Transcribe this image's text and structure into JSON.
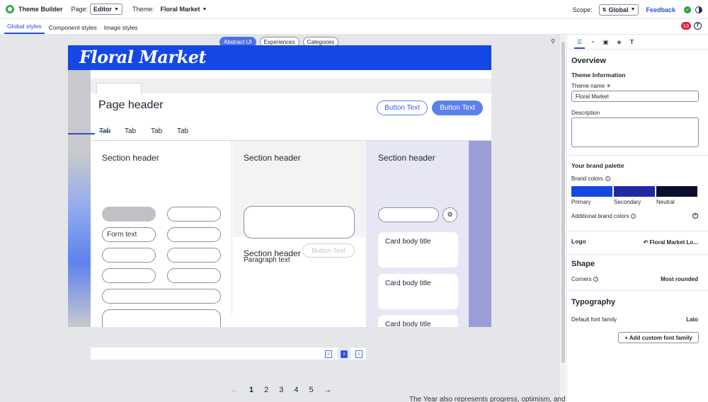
{
  "topbar": {
    "app_title": "Theme Builder",
    "page_label": "Page:",
    "page_value": "Editor",
    "theme_label": "Theme:",
    "theme_value": "Floral Market",
    "scope_label": "Scope:",
    "scope_value": "Global",
    "feedback": "Feedback"
  },
  "subtabs": [
    "Global styles",
    "Component styles",
    "Image styles"
  ],
  "notifications_count": "13",
  "canvas": {
    "modes": [
      "Abstract UI",
      "Experiences",
      "Categories"
    ]
  },
  "preview": {
    "brand_name": "Floral Market",
    "page_header": "Page header",
    "buttons": [
      "Button Text",
      "Button Text"
    ],
    "tabs": [
      "Tab",
      "Tab",
      "Tab",
      "Tab"
    ],
    "section_header": "Section header",
    "form_text": "Form text",
    "disabled_button": "Button Text",
    "paragraph": "Paragraph text",
    "card_title": "Card body title"
  },
  "pagination": {
    "prev": "←",
    "pages": [
      "1",
      "2",
      "3",
      "4",
      "5"
    ],
    "next": "→",
    "current": "1"
  },
  "cutoff_text": "The Year also represents progress, optimism, and determination",
  "panel": {
    "overview": "Overview",
    "theme_info": "Theme Information",
    "theme_name_label": "Theme name ✳",
    "theme_name_value": "Floral Market",
    "description_label": "Description",
    "brand_palette": "Your brand palette",
    "brand_colors": "Brand colors",
    "swatches": [
      {
        "name": "Primary",
        "color": "#1547e6"
      },
      {
        "name": "Secondary",
        "color": "#2229a8"
      },
      {
        "name": "Neutral",
        "color": "#0d0f2e"
      }
    ],
    "additional_colors": "Additional brand colors",
    "logo_label": "Logo",
    "logo_value": "Floral Market Lo...",
    "shape_title": "Shape",
    "corners_label": "Corners",
    "corners_value": "Most rounded",
    "typography_title": "Typography",
    "font_label": "Default font family",
    "font_value": "Lato",
    "add_font": "+ Add custom font family"
  }
}
